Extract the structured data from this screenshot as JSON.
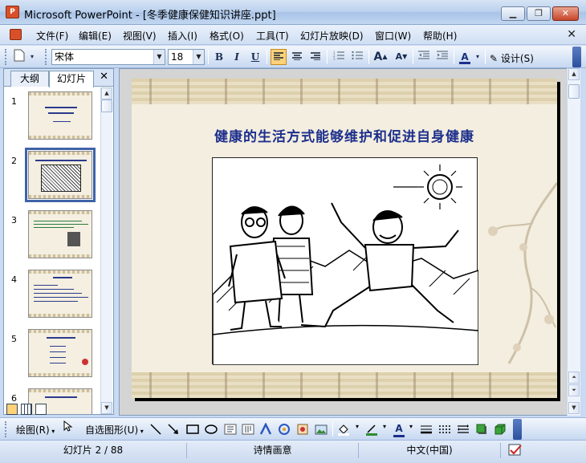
{
  "window": {
    "title": "Microsoft PowerPoint - [冬季健康保健知识讲座.ppt]",
    "min_symbol": "▁",
    "max_symbol": "❐",
    "close_symbol": "✕"
  },
  "menu": {
    "items": [
      "文件(F)",
      "编辑(E)",
      "视图(V)",
      "插入(I)",
      "格式(O)",
      "工具(T)",
      "幻灯片放映(D)",
      "窗口(W)",
      "帮助(H)"
    ],
    "close_symbol": "✕"
  },
  "toolbar": {
    "font_name": "宋体",
    "font_size": "18",
    "bold": "B",
    "italic": "I",
    "underline": "U",
    "grow_font": "A",
    "shrink_font": "A",
    "font_color": "A",
    "design_label": "设计(S)"
  },
  "left_panel": {
    "tabs": [
      "大纲",
      "幻灯片"
    ],
    "active_tab": "幻灯片",
    "close_symbol": "✕",
    "slide_numbers": [
      "1",
      "2",
      "3",
      "4",
      "5",
      "6"
    ],
    "selected_slide": 2
  },
  "slide": {
    "title": "健康的生活方式能够维护和促进自身健康"
  },
  "drawing_toolbar": {
    "draw_label": "绘图(R)",
    "autoshapes_label": "自选图形(U)"
  },
  "status_bar": {
    "slide_position": "幻灯片 2 / 88",
    "design_template": "诗情画意",
    "language": "中文(中国)"
  }
}
